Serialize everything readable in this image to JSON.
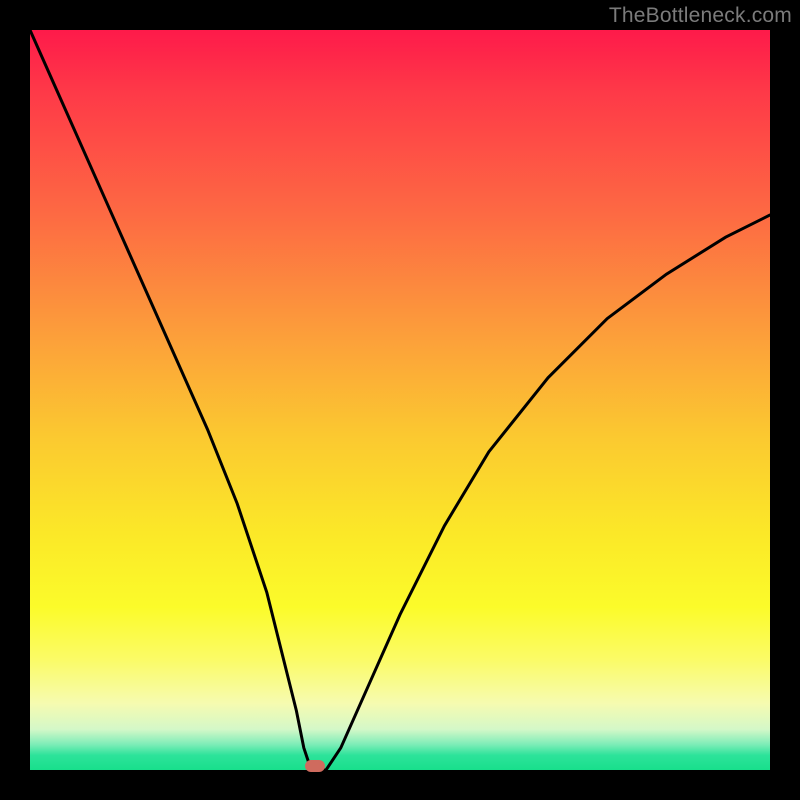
{
  "watermark": {
    "text": "TheBottleneck.com"
  },
  "chart_data": {
    "type": "line",
    "title": "",
    "xlabel": "",
    "ylabel": "",
    "xlim": [
      0,
      100
    ],
    "ylim": [
      0,
      100
    ],
    "grid": false,
    "legend": false,
    "background": "rainbow-vertical-red-to-green",
    "series": [
      {
        "name": "bottleneck-curve",
        "x": [
          0,
          4,
          8,
          12,
          16,
          20,
          24,
          28,
          32,
          34,
          36,
          37,
          38,
          40,
          42,
          46,
          50,
          56,
          62,
          70,
          78,
          86,
          94,
          100
        ],
        "y": [
          100,
          91,
          82,
          73,
          64,
          55,
          46,
          36,
          24,
          16,
          8,
          3,
          0,
          0,
          3,
          12,
          21,
          33,
          43,
          53,
          61,
          67,
          72,
          75
        ]
      }
    ],
    "marker": {
      "x": 38.5,
      "y": 0.5,
      "shape": "rounded-rect",
      "color": "#cf6b5e"
    }
  },
  "colors": {
    "frame": "#000000",
    "curve": "#000000",
    "marker": "#cf6b5e",
    "watermark": "#7b7b7b"
  }
}
